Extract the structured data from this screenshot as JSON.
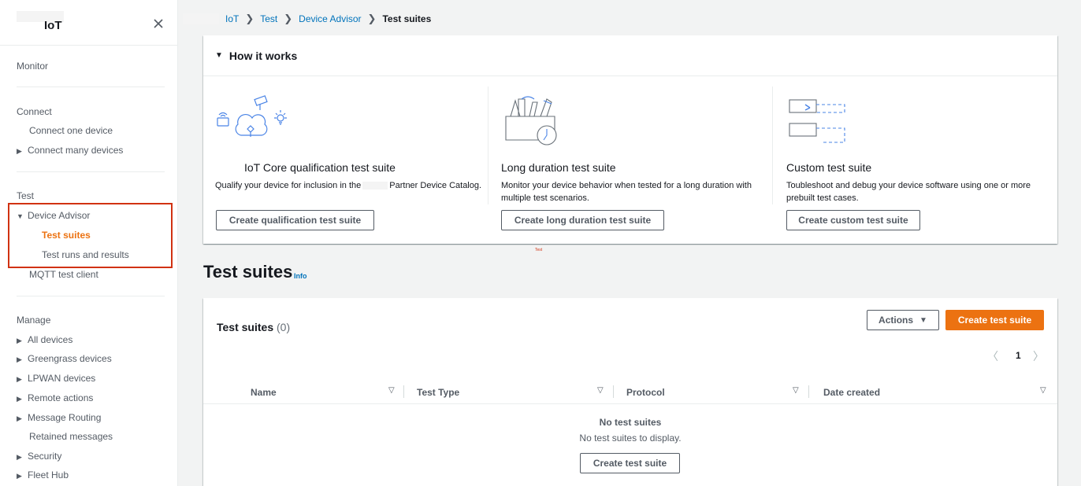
{
  "sidebar": {
    "title": "IoT",
    "sections": {
      "monitor": "Monitor",
      "connect": "Connect",
      "test": "Test",
      "manage": "Manage"
    },
    "connect_items": [
      "Connect one device",
      "Connect many devices"
    ],
    "test_items": {
      "device_advisor": "Device Advisor",
      "test_suites": "Test suites",
      "test_runs": "Test runs and results",
      "mqtt": "MQTT test client"
    },
    "manage_items": [
      "All devices",
      "Greengrass devices",
      "LPWAN devices",
      "Remote actions",
      "Message Routing",
      "Retained messages",
      "Security",
      "Fleet Hub"
    ]
  },
  "breadcrumb": {
    "items": [
      "IoT",
      "Test",
      "Device Advisor"
    ],
    "current": "Test suites"
  },
  "how_it_works": {
    "header": "How it works",
    "columns": [
      {
        "title": "IoT Core qualification test suite",
        "desc_before": "Qualify your device for inclusion in the",
        "desc_after": "Partner Device Catalog.",
        "button": "Create qualification test suite"
      },
      {
        "title": "Long duration test suite",
        "desc": "Monitor your device behavior when tested for a long duration with multiple test scenarios.",
        "button": "Create long duration test suite"
      },
      {
        "title": "Custom test suite",
        "desc": "Toubleshoot and debug your device software using one or more prebuilt test cases.",
        "button": "Create custom test suite"
      }
    ],
    "tiny_label": "Test"
  },
  "page": {
    "title": "Test suites",
    "info": "Info"
  },
  "table": {
    "title": "Test suites",
    "count": "(0)",
    "actions_label": "Actions",
    "create_label": "Create test suite",
    "page_number": "1",
    "columns": [
      "Name",
      "Test Type",
      "Protocol",
      "Date created"
    ],
    "empty_title": "No test suites",
    "empty_desc": "No test suites to display.",
    "empty_button": "Create test suite"
  },
  "colors": {
    "accent": "#ec7211",
    "link": "#0073bb",
    "highlight_border": "#d13212",
    "illustration": "#4a84e6"
  },
  "icons": {
    "close": "close-icon",
    "expand": "caret-right-icon",
    "collapse": "caret-down-icon",
    "breadcrumb_sep": "chevron-right-icon",
    "actions_dropdown": "caret-down-icon",
    "page_prev": "chevron-left-icon",
    "page_next": "chevron-right-icon",
    "sort": "sort-down-icon"
  }
}
